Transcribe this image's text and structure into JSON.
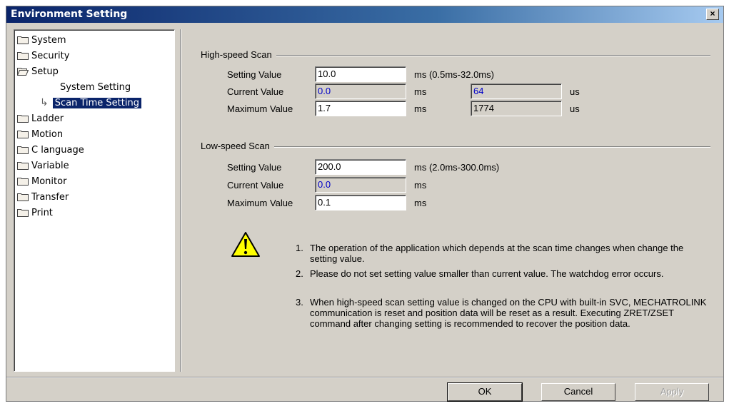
{
  "window": {
    "title": "Environment Setting",
    "close_symbol": "×"
  },
  "tree": {
    "items": [
      {
        "label": "System"
      },
      {
        "label": "Security"
      },
      {
        "label": "Setup"
      },
      {
        "label": "System Setting"
      },
      {
        "label": "Scan Time Setting"
      },
      {
        "label": "Ladder"
      },
      {
        "label": "Motion"
      },
      {
        "label": "C language"
      },
      {
        "label": "Variable"
      },
      {
        "label": "Monitor"
      },
      {
        "label": "Transfer"
      },
      {
        "label": "Print"
      }
    ]
  },
  "high": {
    "title": "High-speed Scan",
    "setting_label": "Setting Value",
    "setting_value": "10.0",
    "setting_range": "ms (0.5ms-32.0ms)",
    "current_label": "Current Value",
    "current_value": "0.0",
    "current_ms": "ms",
    "current_us_value": "64",
    "current_us": "us",
    "max_label": "Maximum Value",
    "max_value": "1.7",
    "max_ms": "ms",
    "max_us_value": "1774",
    "max_us": "us"
  },
  "low": {
    "title": "Low-speed Scan",
    "setting_label": "Setting Value",
    "setting_value": "200.0",
    "setting_range": "ms (2.0ms-300.0ms)",
    "current_label": "Current Value",
    "current_value": "0.0",
    "current_ms": "ms",
    "max_label": "Maximum Value",
    "max_value": "0.1",
    "max_ms": "ms"
  },
  "notes": [
    {
      "num": "1.",
      "text": "The operation of the application which depends at the scan time changes when change the setting value."
    },
    {
      "num": "2.",
      "text": "Please do not set setting value smaller than current value.  The watchdog error occurs."
    },
    {
      "num": "3.",
      "text": "When high-speed scan setting value is changed on the CPU with built-in SVC, MECHATROLINK communication is reset and position data will be reset as a result. Executing ZRET/ZSET command after changing setting is recommended to recover the position data."
    }
  ],
  "buttons": {
    "ok": "OK",
    "cancel": "Cancel",
    "apply": "Apply"
  },
  "colors": {
    "title_bar": "#0a246a",
    "selection": "#0a246a",
    "face": "#d4d0c8",
    "value_blue": "#0000c8",
    "warning": "#ffff00"
  }
}
